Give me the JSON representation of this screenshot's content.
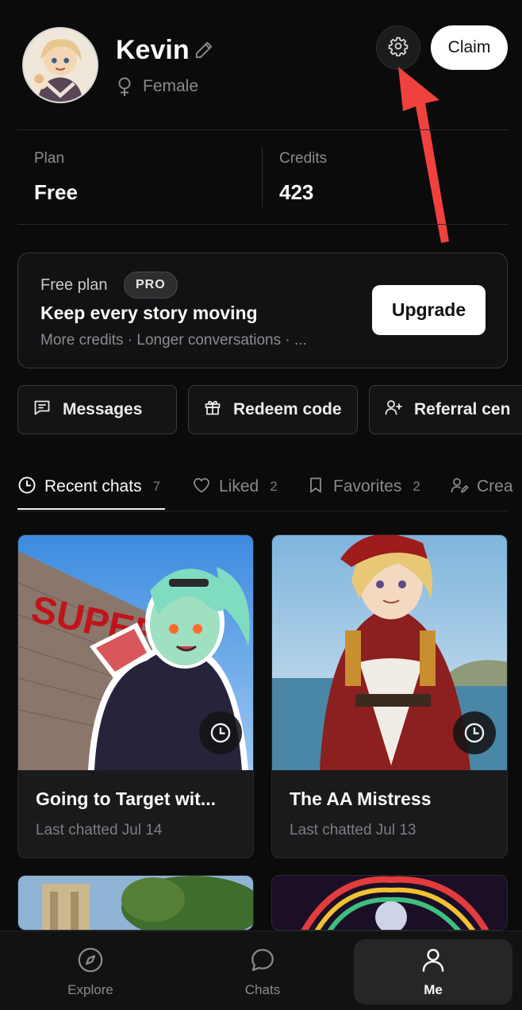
{
  "profile": {
    "name": "Kevin",
    "gender": "Female"
  },
  "header": {
    "claim_label": "Claim"
  },
  "stats": {
    "plan_label": "Plan",
    "plan_value": "Free",
    "credits_label": "Credits",
    "credits_value": "423"
  },
  "plan_card": {
    "title": "Free plan",
    "badge": "PRO",
    "heading": "Keep every story moving",
    "subtitle": "More credits · Longer conversations · ...",
    "upgrade_label": "Upgrade"
  },
  "actions": [
    {
      "label": "Messages",
      "icon": "message-square-icon"
    },
    {
      "label": "Redeem code",
      "icon": "gift-icon"
    },
    {
      "label": "Referral cen",
      "icon": "user-plus-icon"
    }
  ],
  "tabs": [
    {
      "label": "Recent chats",
      "count": "7",
      "icon": "clock-icon"
    },
    {
      "label": "Liked",
      "count": "2",
      "icon": "heart-icon"
    },
    {
      "label": "Favorites",
      "count": "2",
      "icon": "bookmark-icon"
    },
    {
      "label": "Crea",
      "count": "",
      "icon": "user-edit-icon"
    }
  ],
  "cards": [
    {
      "title": "Going to Target wit...",
      "subtitle": "Last chatted Jul 14"
    },
    {
      "title": "The AA Mistress",
      "subtitle": "Last chatted Jul 13"
    }
  ],
  "nav": [
    {
      "label": "Explore",
      "icon": "compass-icon"
    },
    {
      "label": "Chats",
      "icon": "chat-bubble-icon"
    },
    {
      "label": "Me",
      "icon": "user-icon"
    }
  ],
  "colors": {
    "background": "#0b0b0c",
    "annotation_arrow": "#f0413f"
  }
}
